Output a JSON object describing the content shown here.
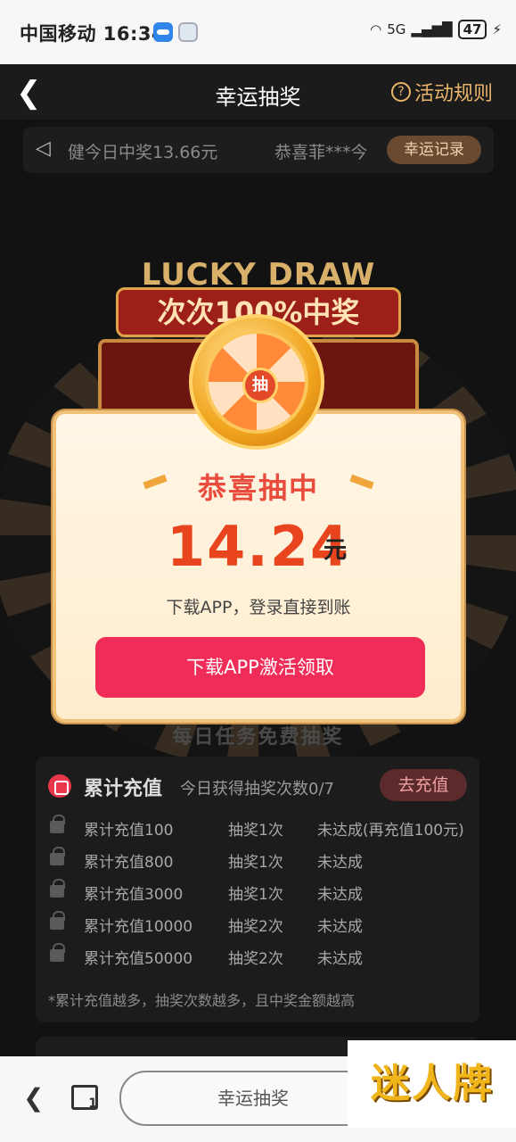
{
  "status_bar": {
    "carrier_time": "中国移动 16:34",
    "signal": "5G",
    "battery": "47"
  },
  "header": {
    "title": "幸运抽奖",
    "rules_label": "活动规则"
  },
  "marquee": {
    "text_1": "健今日中奖13.66元",
    "text_2": "恭喜菲***今",
    "record_button": "幸运记录"
  },
  "banner": {
    "lucky_text": "LUCKY DRAW",
    "plaque_text": "次次100%中奖",
    "coin_label": "抽"
  },
  "popup": {
    "heading": "恭喜抽中",
    "amount": "14.24",
    "unit": "元",
    "hint": "下载APP，登录直接到账",
    "cta": "下载APP激活领取"
  },
  "tasks": {
    "section_title": "每日任务免费抽奖",
    "card": {
      "name": "累计充值",
      "subtitle": "今日获得抽奖次数0/7",
      "go_button": "去充值",
      "rows": [
        {
          "task": "累计充值100",
          "reward": "抽奖1次",
          "status": "未达成(再充值100元)"
        },
        {
          "task": "累计充值800",
          "reward": "抽奖1次",
          "status": "未达成"
        },
        {
          "task": "累计充值3000",
          "reward": "抽奖1次",
          "status": "未达成"
        },
        {
          "task": "累计充值10000",
          "reward": "抽奖2次",
          "status": "未达成"
        },
        {
          "task": "累计充值50000",
          "reward": "抽奖2次",
          "status": "未达成"
        }
      ],
      "note": "*累计充值越多，抽奖次数越多，且中奖金额越高"
    }
  },
  "browser_bar": {
    "address": "幸运抽奖",
    "tab_count": "1"
  },
  "watermark": "迷人牌",
  "colors": {
    "accent_gold": "#e8b46a",
    "cta_pink": "#f02d58",
    "amount_red": "#e8441e"
  }
}
